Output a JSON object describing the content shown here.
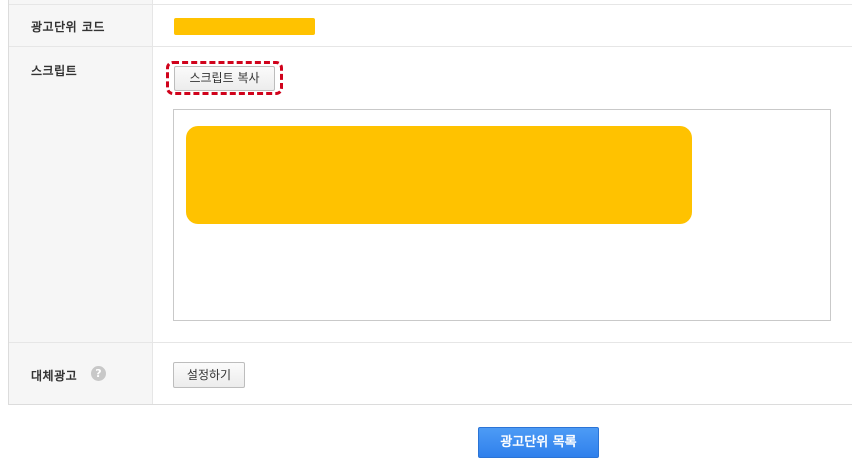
{
  "rows": {
    "ad_unit_code": {
      "label": "광고단위 코드"
    },
    "script": {
      "label": "스크립트",
      "copy_button": "스크립트 복사"
    },
    "fallback_ad": {
      "label": "대체광고",
      "help_icon": "?",
      "setup_button": "설정하기"
    }
  },
  "footer": {
    "list_button": "광고단위 목록"
  },
  "colors": {
    "redaction": "#ffc200",
    "highlight": "#d0021b",
    "primary_button": "#3b8af0"
  },
  "icons": {
    "help": "question-circle-icon"
  }
}
